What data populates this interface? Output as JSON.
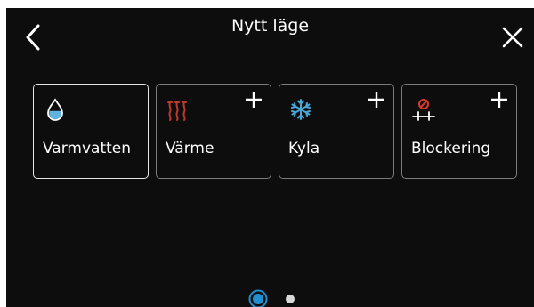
{
  "header": {
    "title": "Nytt läge",
    "back_icon": "chevron-left-icon",
    "close_icon": "close-icon"
  },
  "cards": [
    {
      "label": "Varmvatten",
      "icon": "water-drop-icon",
      "selected": true,
      "has_add": false
    },
    {
      "label": "Värme",
      "icon": "heating-icon",
      "selected": false,
      "has_add": true
    },
    {
      "label": "Kyla",
      "icon": "snowflake-icon",
      "selected": false,
      "has_add": true
    },
    {
      "label": "Blockering",
      "icon": "blocked-icon",
      "selected": false,
      "has_add": true
    }
  ],
  "pagination": {
    "current_page": 1,
    "total_pages": 2
  },
  "colors": {
    "background": "#0d0d0d",
    "text": "#ffffff",
    "card_border": "#7b7b7b",
    "card_border_selected": "#e6e6e6",
    "water": "#5fb3dd",
    "heat": "#c0392b",
    "cold": "#4aa6d4",
    "block": "#d9382b",
    "page_active": "#1f8fd0"
  }
}
